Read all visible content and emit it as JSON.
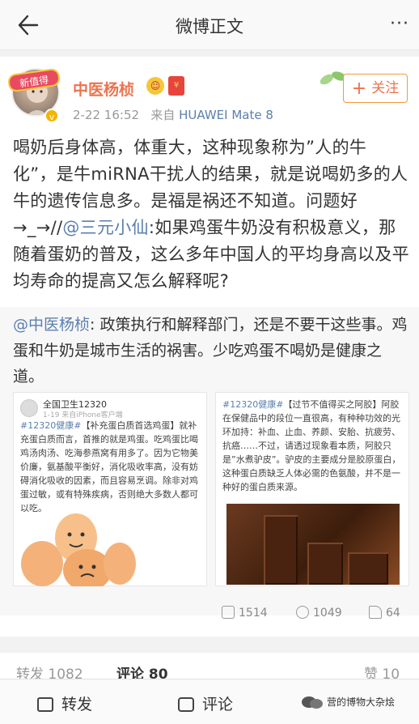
{
  "nav": {
    "title": "微博正文",
    "more": "···"
  },
  "post": {
    "username": "中医杨桢",
    "avatar_badge": "新值得",
    "timestamp": "2-22 16:52",
    "source_prefix": "来自",
    "device": "HUAWEI Mate 8",
    "follow_label": "关注",
    "text_before_mention": "喝奶后身体高，体重大，这种现象称为”人的牛化”，是牛miRNA干扰人的结果，就是说喝奶多的人牛的遗传信息多。是福是祸还不知道。问题好→_→//",
    "mention": "@三元小仙",
    "text_after_mention": ":如果鸡蛋牛奶没有积极意义，那随着蛋奶的普及，这么多年中国人的平均身高以及平均寿命的提高又怎么解释呢?"
  },
  "repost": {
    "mention": "@中医杨桢",
    "text": ": 政策执行和解释部门，还是不要干这些事。鸡蛋和牛奶是城市生活的祸害。少吃鸡蛋不喝奶是健康之道。"
  },
  "image1": {
    "name": "全国卫生12320",
    "sub": "1-19 来自iPhone客户端",
    "tag": "#12320健康#",
    "body": "【补充蛋白质首选鸡蛋】就补充蛋白质而言，首推的就是鸡蛋。吃鸡蛋比喝鸡汤肉汤、吃海参燕窝有用多了。因为它物美价廉，氨基酸平衡好，消化吸收率高，没有妨碍消化吸收的因素，而且容易烹调。除非对鸡蛋过敏，或有特殊疾病，否则绝大多数人都可以吃。"
  },
  "image2": {
    "tag": "#12320健康#",
    "body": "【过节不值得买之阿胶】阿胶在保健品中的段位一直很高，有种种功效的光环加持：补血、止血、养颜、安胎、抗疲劳、抗癌……不过，请透过现象看本质，阿胶只是”水煮驴皮”。驴皮的主要成分是胶原蛋白，这种蛋白质缺乏人体必需的色氨酸，并不是一种好的蛋白质来源。"
  },
  "stats": {
    "reposts": "1514",
    "comments": "1049",
    "likes": "64"
  },
  "tabs": {
    "repost": "转发 1082",
    "comment": "评论 80",
    "like": "赞 10"
  },
  "bottom": {
    "repost": "转发",
    "comment": "评论",
    "watermark": "营的博物大杂烩"
  },
  "colors": {
    "accent": "#eb7350",
    "link": "#5b7fb0"
  }
}
